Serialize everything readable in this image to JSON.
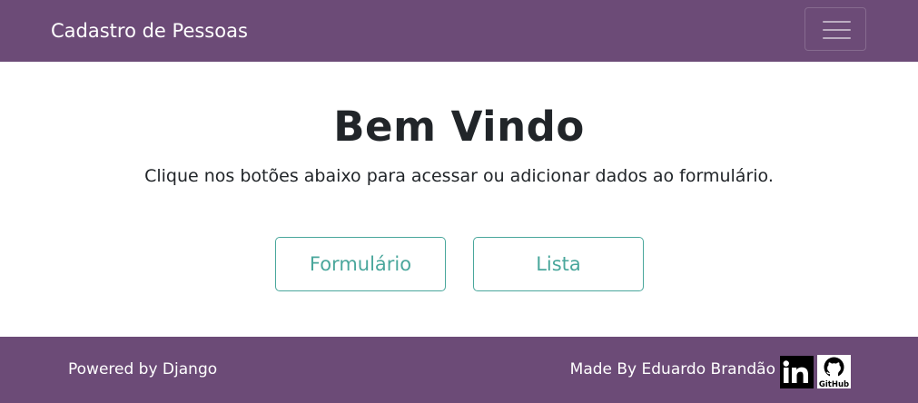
{
  "navbar": {
    "brand": "Cadastro de Pessoas",
    "toggler_icon": "hamburger-menu-icon",
    "background": "#6c4b77"
  },
  "hero": {
    "title": "Bem Vindo",
    "lead": "Clique nos botões abaixo para acessar ou adicionar dados ao formulário."
  },
  "buttons": {
    "form_label": "Formulário",
    "list_label": "Lista",
    "accent": "#4aa79c"
  },
  "footer": {
    "powered": "Powered by Django",
    "made_by": "Made By Eduardo Brandão",
    "linkedin_icon": "linkedin-icon",
    "github_icon": "github-icon",
    "github_logo_text": "GitHub",
    "background": "#6c4b77"
  }
}
